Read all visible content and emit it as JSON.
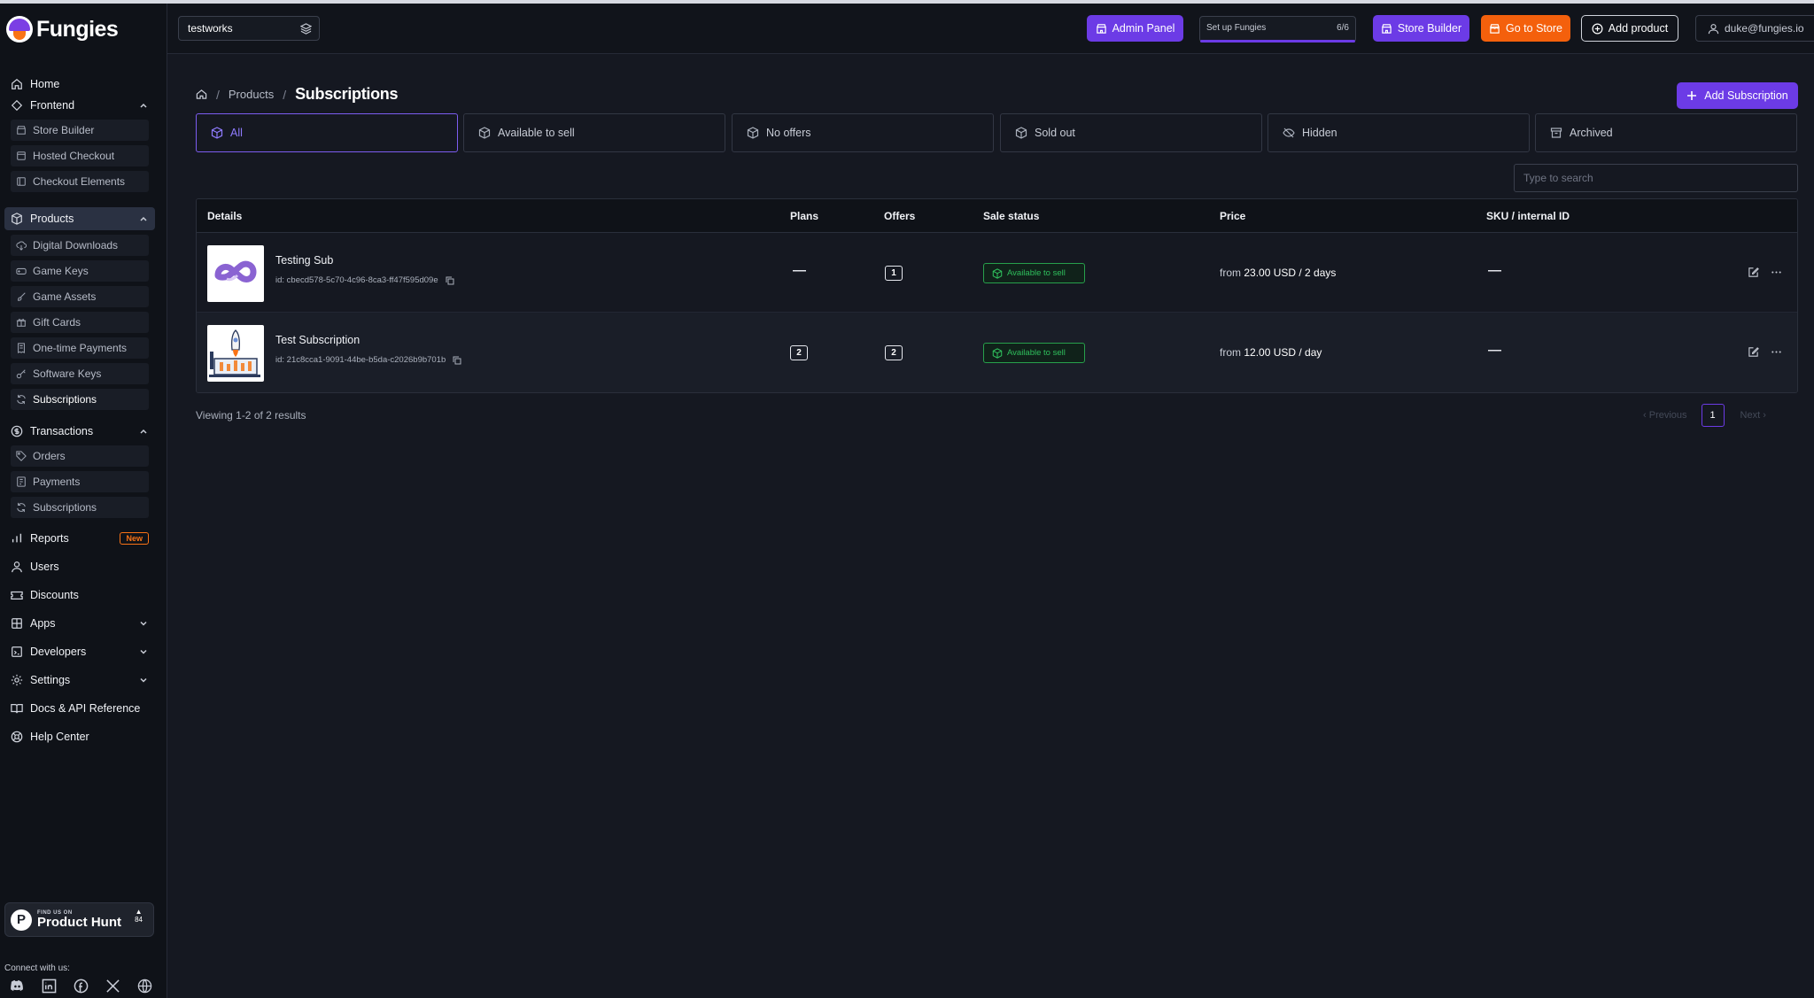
{
  "app": {
    "name": "Fungies"
  },
  "store": {
    "name": "testworks"
  },
  "topbar": {
    "admin_panel": "Admin Panel",
    "setup_label": "Set up Fungies",
    "setup_count": "6/6",
    "store_builder": "Store Builder",
    "go_to_store": "Go to Store",
    "add_product": "Add product",
    "user_email": "duke@fungies.io"
  },
  "sidebar": {
    "home": "Home",
    "frontend": {
      "label": "Frontend",
      "items": [
        "Store Builder",
        "Hosted Checkout",
        "Checkout Elements"
      ]
    },
    "products": {
      "label": "Products",
      "items": [
        "Digital Downloads",
        "Game Keys",
        "Game Assets",
        "Gift Cards",
        "One-time Payments",
        "Software Keys",
        "Subscriptions"
      ]
    },
    "transactions": {
      "label": "Transactions",
      "items": [
        "Orders",
        "Payments",
        "Subscriptions"
      ]
    },
    "reports": "Reports",
    "reports_badge": "New",
    "users": "Users",
    "discounts": "Discounts",
    "apps": "Apps",
    "developers": "Developers",
    "settings": "Settings",
    "docs": "Docs & API Reference",
    "help": "Help Center",
    "product_hunt": {
      "small": "FIND US ON",
      "big": "Product Hunt",
      "votes": "84"
    },
    "connect": "Connect with us:"
  },
  "breadcrumb": {
    "parent": "Products",
    "current": "Subscriptions"
  },
  "add_subscription": "Add Subscription",
  "tabs": [
    "All",
    "Available to sell",
    "No offers",
    "Sold out",
    "Hidden",
    "Archived"
  ],
  "search": {
    "placeholder": "Type to search"
  },
  "table": {
    "headers": [
      "Details",
      "Plans",
      "Offers",
      "Sale status",
      "Price",
      "SKU / internal ID"
    ],
    "rows": [
      {
        "name": "Testing Sub",
        "id": "id: cbecd578-5c70-4c96-8ca3-ff47f595d09e",
        "plans": "—",
        "offers": "1",
        "status": "Available to sell",
        "price_prefix": "from",
        "price_value": "23.00 USD / 2 days",
        "sku": "—"
      },
      {
        "name": "Test Subscription",
        "id": "id: 21c8cca1-9091-44be-b5da-c2026b9b701b",
        "plans": "2",
        "offers": "2",
        "status": "Available to sell",
        "price_prefix": "from",
        "price_value": "12.00 USD / day",
        "sku": "—"
      }
    ]
  },
  "pagination": {
    "summary": "Viewing 1-2 of 2 results",
    "previous": "Previous",
    "page": "1",
    "next": "Next"
  }
}
